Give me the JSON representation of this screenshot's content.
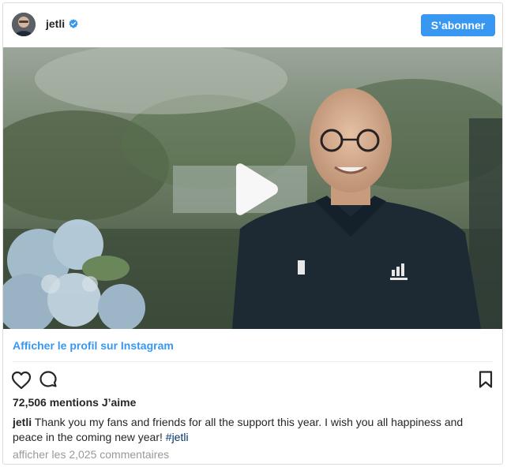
{
  "post": {
    "username": "jetli",
    "verified": true,
    "subscribe_label": "S’abonner",
    "video": {
      "has_play_button": true,
      "description_hint": "video thumbnail"
    },
    "profile_link_label": "Afficher le profil sur Instagram",
    "likes_label": "72,506 mentions J’aime",
    "caption": {
      "username": "jetli",
      "text": " Thank you my fans and friends for all the support this year. I wish you all happiness and peace in the coming new year! ",
      "hashtag": "#jetli"
    },
    "comments_link_label": "afficher les 2,025 commentaires"
  },
  "colors": {
    "accent": "#3897f0",
    "text": "#262626",
    "muted": "#999999",
    "hashtag": "#003569",
    "border": "#dbdbdb"
  },
  "icons": {
    "verified": "verified-badge-icon",
    "play": "play-icon",
    "like": "heart-icon",
    "comment": "comment-icon",
    "save": "bookmark-icon"
  }
}
